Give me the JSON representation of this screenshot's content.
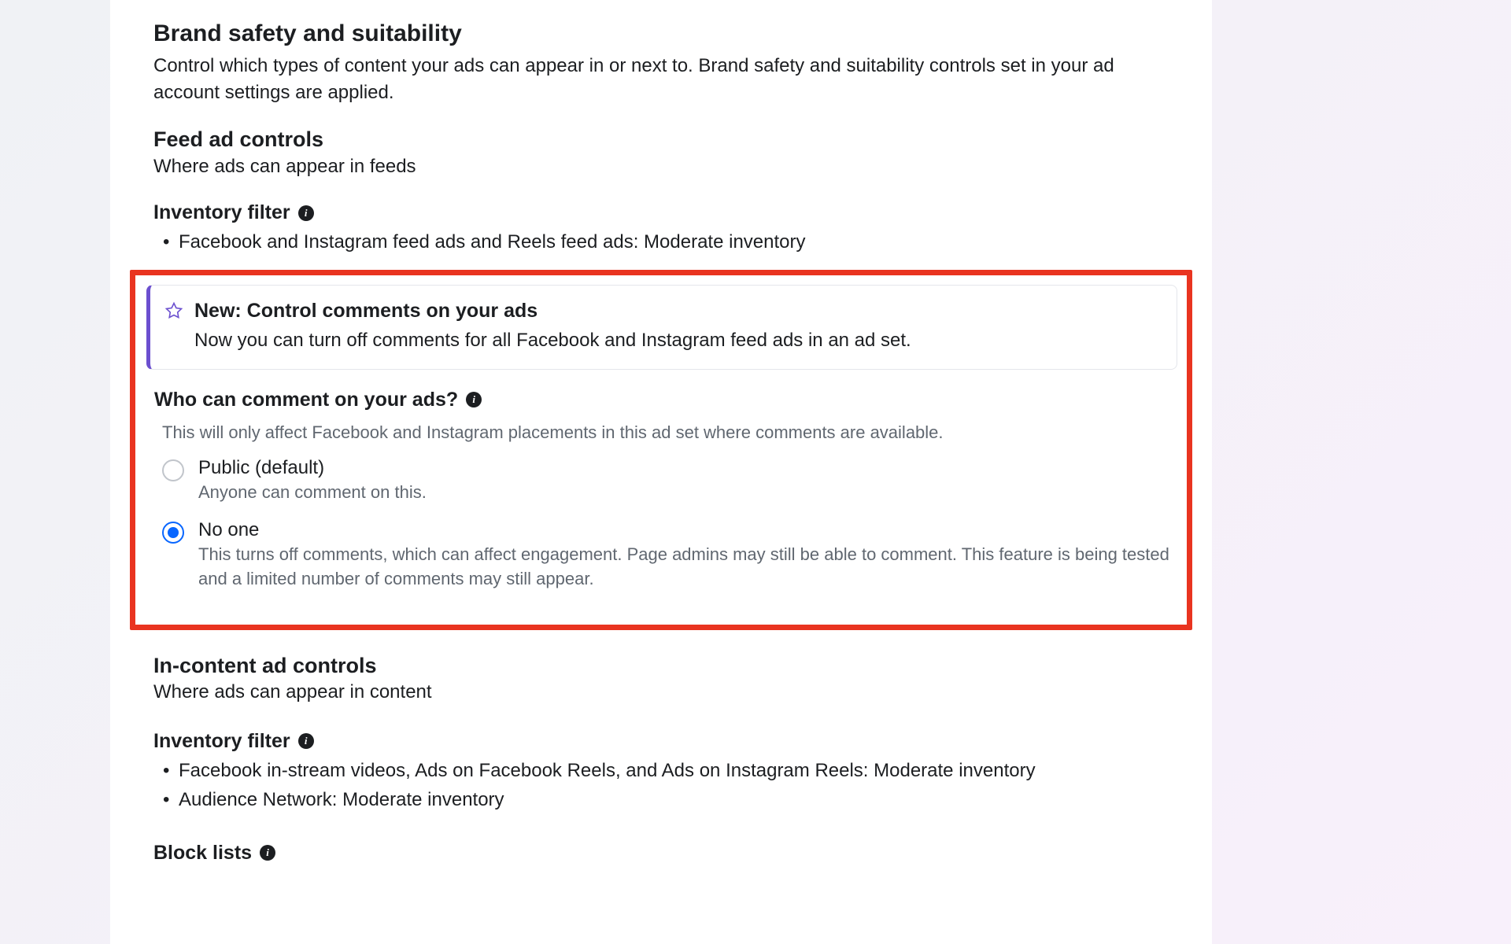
{
  "brandSafety": {
    "title": "Brand safety and suitability",
    "desc": "Control which types of content your ads can appear in or next to. Brand safety and suitability controls set in your ad account settings are applied."
  },
  "feedControls": {
    "title": "Feed ad controls",
    "desc": "Where ads can appear in feeds"
  },
  "inventoryFilter1": {
    "label": "Inventory filter",
    "items": [
      "Facebook and Instagram feed ads and Reels feed ads: Moderate inventory"
    ]
  },
  "callout": {
    "title": "New: Control comments on your ads",
    "desc": "Now you can turn off comments for all Facebook and Instagram feed ads in an ad set."
  },
  "commentSection": {
    "heading": "Who can comment on your ads?",
    "note": "This will only affect Facebook and Instagram placements in this ad set where comments are available.",
    "options": {
      "public": {
        "label": "Public (default)",
        "sub": "Anyone can comment on this."
      },
      "noone": {
        "label": "No one",
        "sub": "This turns off comments, which can affect engagement. Page admins may still be able to comment. This feature is being tested and a limited number of comments may still appear."
      }
    }
  },
  "inContent": {
    "title": "In-content ad controls",
    "desc": "Where ads can appear in content"
  },
  "inventoryFilter2": {
    "label": "Inventory filter",
    "items": [
      "Facebook in-stream videos, Ads on Facebook Reels, and Ads on Instagram Reels: Moderate inventory",
      "Audience Network: Moderate inventory"
    ]
  },
  "blockLists": {
    "label": "Block lists"
  }
}
